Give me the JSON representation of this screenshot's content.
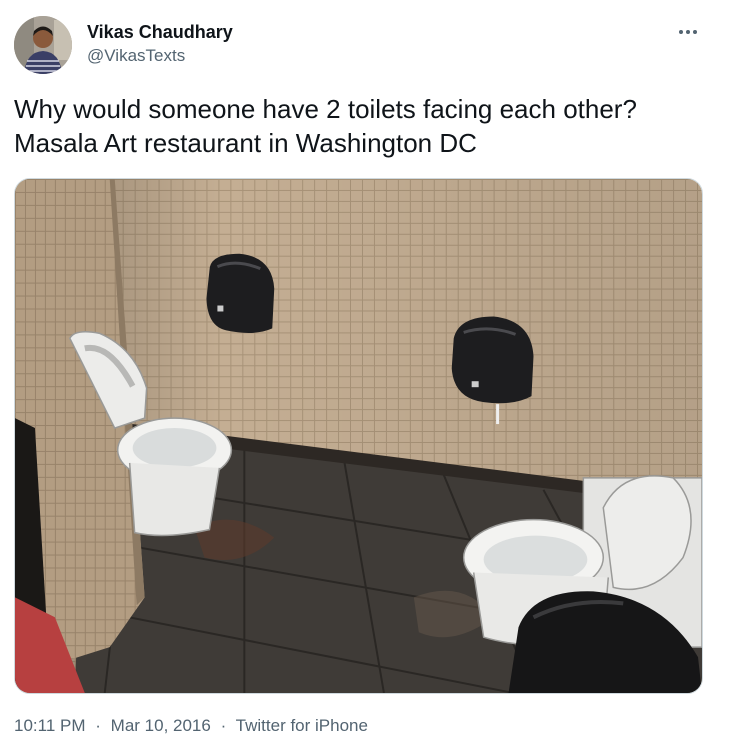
{
  "author": {
    "display_name": "Vikas Chaudhary",
    "handle": "@VikasTexts"
  },
  "tweet": {
    "lines": [
      "Why would someone have 2 toilets facing each other?",
      "Masala Art restaurant in Washington DC"
    ]
  },
  "media": {
    "alt": "Photo of a restroom with two toilets facing each other",
    "colors": {
      "tile_wall": "#c2ad92",
      "floor": "#3e3a36",
      "dispenser": "#1c1c1e",
      "toilet": "#eeeeec"
    }
  },
  "meta": {
    "time": "10:11 PM",
    "separator": "·",
    "date": "Mar 10, 2016",
    "source": "Twitter for iPhone"
  },
  "icons": {
    "more": "more-horizontal-icon"
  }
}
